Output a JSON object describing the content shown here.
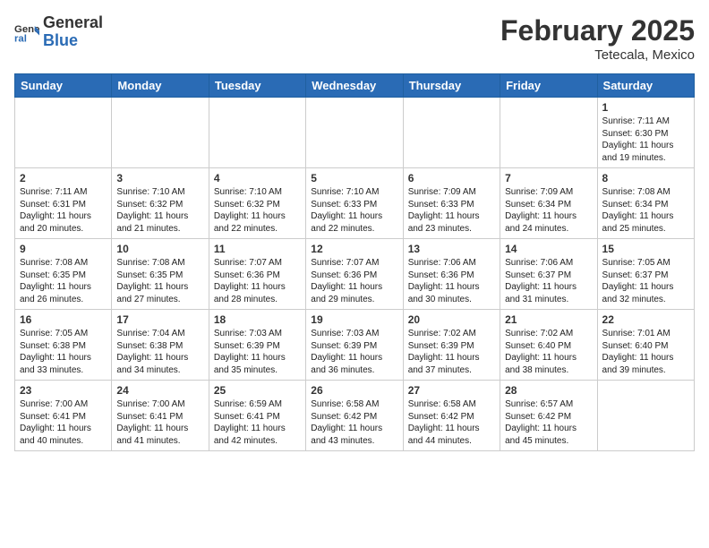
{
  "header": {
    "logo_general": "General",
    "logo_blue": "Blue",
    "title": "February 2025",
    "location": "Tetecala, Mexico"
  },
  "days_of_week": [
    "Sunday",
    "Monday",
    "Tuesday",
    "Wednesday",
    "Thursday",
    "Friday",
    "Saturday"
  ],
  "weeks": [
    [
      {
        "day": "",
        "info": ""
      },
      {
        "day": "",
        "info": ""
      },
      {
        "day": "",
        "info": ""
      },
      {
        "day": "",
        "info": ""
      },
      {
        "day": "",
        "info": ""
      },
      {
        "day": "",
        "info": ""
      },
      {
        "day": "1",
        "info": "Sunrise: 7:11 AM\nSunset: 6:30 PM\nDaylight: 11 hours and 19 minutes."
      }
    ],
    [
      {
        "day": "2",
        "info": "Sunrise: 7:11 AM\nSunset: 6:31 PM\nDaylight: 11 hours and 20 minutes."
      },
      {
        "day": "3",
        "info": "Sunrise: 7:10 AM\nSunset: 6:32 PM\nDaylight: 11 hours and 21 minutes."
      },
      {
        "day": "4",
        "info": "Sunrise: 7:10 AM\nSunset: 6:32 PM\nDaylight: 11 hours and 22 minutes."
      },
      {
        "day": "5",
        "info": "Sunrise: 7:10 AM\nSunset: 6:33 PM\nDaylight: 11 hours and 22 minutes."
      },
      {
        "day": "6",
        "info": "Sunrise: 7:09 AM\nSunset: 6:33 PM\nDaylight: 11 hours and 23 minutes."
      },
      {
        "day": "7",
        "info": "Sunrise: 7:09 AM\nSunset: 6:34 PM\nDaylight: 11 hours and 24 minutes."
      },
      {
        "day": "8",
        "info": "Sunrise: 7:08 AM\nSunset: 6:34 PM\nDaylight: 11 hours and 25 minutes."
      }
    ],
    [
      {
        "day": "9",
        "info": "Sunrise: 7:08 AM\nSunset: 6:35 PM\nDaylight: 11 hours and 26 minutes."
      },
      {
        "day": "10",
        "info": "Sunrise: 7:08 AM\nSunset: 6:35 PM\nDaylight: 11 hours and 27 minutes."
      },
      {
        "day": "11",
        "info": "Sunrise: 7:07 AM\nSunset: 6:36 PM\nDaylight: 11 hours and 28 minutes."
      },
      {
        "day": "12",
        "info": "Sunrise: 7:07 AM\nSunset: 6:36 PM\nDaylight: 11 hours and 29 minutes."
      },
      {
        "day": "13",
        "info": "Sunrise: 7:06 AM\nSunset: 6:36 PM\nDaylight: 11 hours and 30 minutes."
      },
      {
        "day": "14",
        "info": "Sunrise: 7:06 AM\nSunset: 6:37 PM\nDaylight: 11 hours and 31 minutes."
      },
      {
        "day": "15",
        "info": "Sunrise: 7:05 AM\nSunset: 6:37 PM\nDaylight: 11 hours and 32 minutes."
      }
    ],
    [
      {
        "day": "16",
        "info": "Sunrise: 7:05 AM\nSunset: 6:38 PM\nDaylight: 11 hours and 33 minutes."
      },
      {
        "day": "17",
        "info": "Sunrise: 7:04 AM\nSunset: 6:38 PM\nDaylight: 11 hours and 34 minutes."
      },
      {
        "day": "18",
        "info": "Sunrise: 7:03 AM\nSunset: 6:39 PM\nDaylight: 11 hours and 35 minutes."
      },
      {
        "day": "19",
        "info": "Sunrise: 7:03 AM\nSunset: 6:39 PM\nDaylight: 11 hours and 36 minutes."
      },
      {
        "day": "20",
        "info": "Sunrise: 7:02 AM\nSunset: 6:39 PM\nDaylight: 11 hours and 37 minutes."
      },
      {
        "day": "21",
        "info": "Sunrise: 7:02 AM\nSunset: 6:40 PM\nDaylight: 11 hours and 38 minutes."
      },
      {
        "day": "22",
        "info": "Sunrise: 7:01 AM\nSunset: 6:40 PM\nDaylight: 11 hours and 39 minutes."
      }
    ],
    [
      {
        "day": "23",
        "info": "Sunrise: 7:00 AM\nSunset: 6:41 PM\nDaylight: 11 hours and 40 minutes."
      },
      {
        "day": "24",
        "info": "Sunrise: 7:00 AM\nSunset: 6:41 PM\nDaylight: 11 hours and 41 minutes."
      },
      {
        "day": "25",
        "info": "Sunrise: 6:59 AM\nSunset: 6:41 PM\nDaylight: 11 hours and 42 minutes."
      },
      {
        "day": "26",
        "info": "Sunrise: 6:58 AM\nSunset: 6:42 PM\nDaylight: 11 hours and 43 minutes."
      },
      {
        "day": "27",
        "info": "Sunrise: 6:58 AM\nSunset: 6:42 PM\nDaylight: 11 hours and 44 minutes."
      },
      {
        "day": "28",
        "info": "Sunrise: 6:57 AM\nSunset: 6:42 PM\nDaylight: 11 hours and 45 minutes."
      },
      {
        "day": "",
        "info": ""
      }
    ]
  ]
}
